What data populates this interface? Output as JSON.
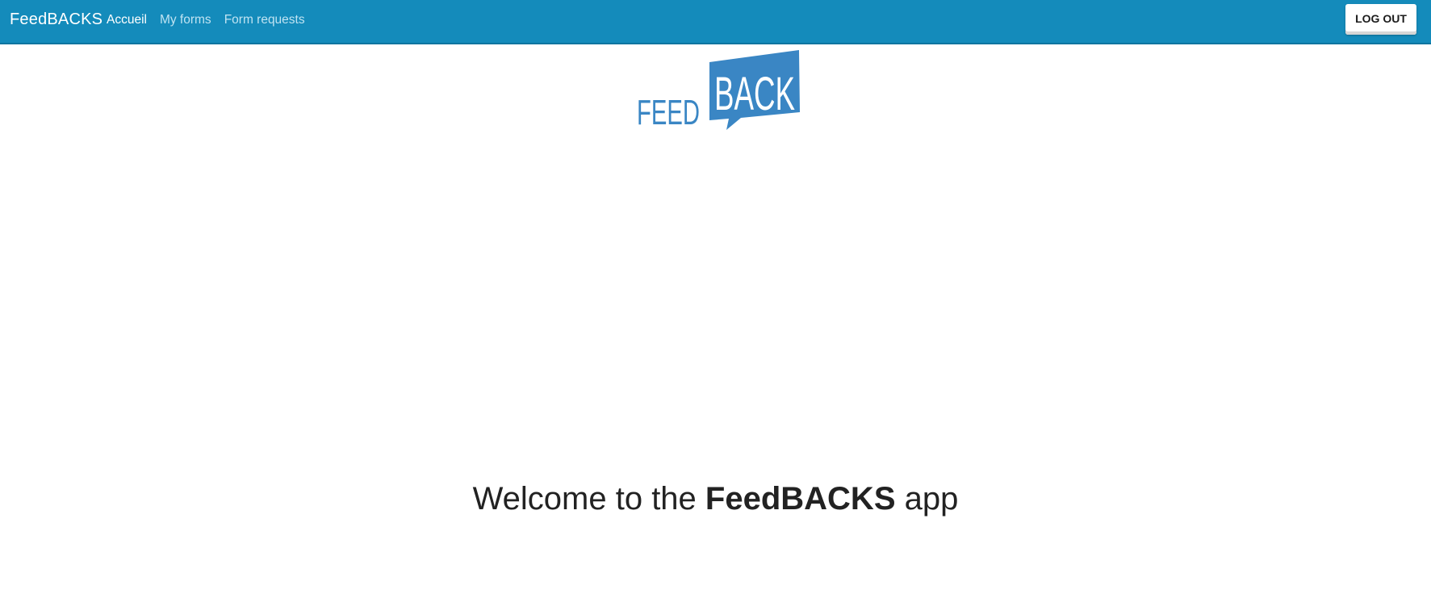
{
  "navbar": {
    "brand": "FeedBACKS",
    "links": [
      {
        "label": "Accueil",
        "active": true
      },
      {
        "label": "My forms",
        "active": false
      },
      {
        "label": "Form requests",
        "active": false
      }
    ],
    "logout_label": "LOG OUT"
  },
  "logo": {
    "left_text": "FEED",
    "right_text": "BACK",
    "color": "#3a86c4"
  },
  "welcome": {
    "prefix": "Welcome to the ",
    "app_name": "FeedBACKS",
    "suffix": " app"
  },
  "colors": {
    "navbar_bg": "#148bbb",
    "link_inactive": "#bfe3f2",
    "link_active": "#ffffff"
  }
}
